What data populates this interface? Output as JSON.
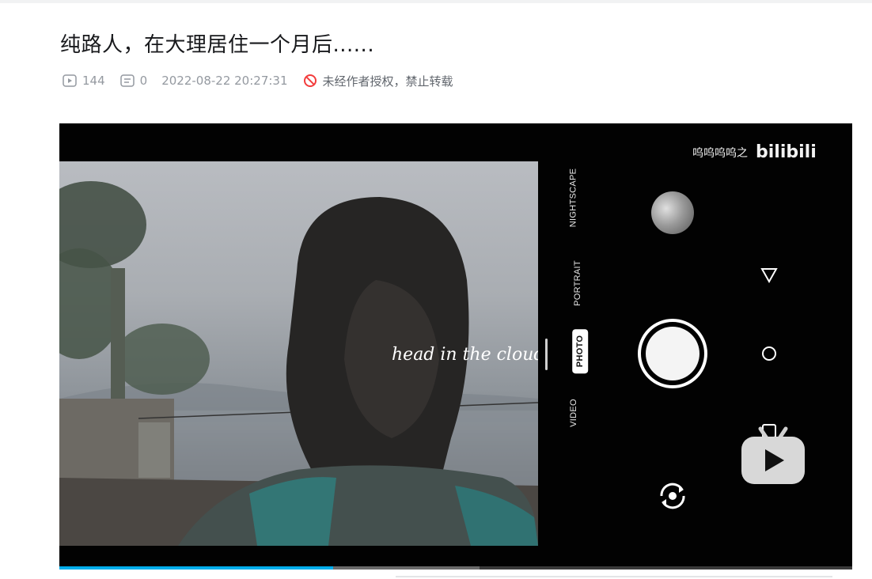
{
  "page": {
    "title": "纯路人，在大理居住一个月后......"
  },
  "meta": {
    "views": "144",
    "danmaku": "0",
    "date": "2022-08-22 20:27:31",
    "copyright_notice": "未经作者授权，禁止转载"
  },
  "player": {
    "overlay_text": "head in the clouds",
    "watermark_user": "呜呜呜呜之",
    "watermark_brand": "bilibili",
    "camera_modes": [
      "NIGHTSCAPE",
      "PORTRAIT",
      "PHOTO",
      "VIDEO"
    ],
    "active_mode": "PHOTO",
    "progress": {
      "played": 0.345,
      "buffered": 0.53
    }
  },
  "colors": {
    "accent": "#00aeec",
    "ban_red": "#f33c3c",
    "meta_gray": "#9499a0"
  },
  "icons": [
    "play-count-icon",
    "danmaku-icon",
    "no-repost-icon",
    "triangle-icon",
    "circle-icon",
    "square-icon",
    "switch-camera-icon",
    "bili-tv-logo-icon"
  ]
}
